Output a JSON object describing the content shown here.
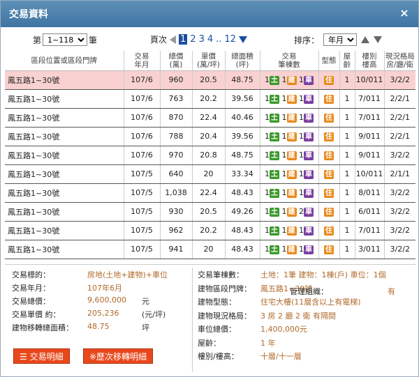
{
  "dialog": {
    "title": "交易資料",
    "close_symbol": "×"
  },
  "toolbar": {
    "page_prefix": "第",
    "page_range": "1~118",
    "page_suffix": "筆",
    "pager_label": "頁次",
    "pages": [
      "1",
      "2",
      "3",
      "4"
    ],
    "ellipsis": "..",
    "last_page": "12",
    "sort_label": "排序：",
    "sort_value": "年月"
  },
  "table": {
    "headers": [
      "區段位置或區段門牌",
      "交易\n年月",
      "總價\n(萬)",
      "單價\n(萬/坪)",
      "總面積\n(坪)",
      "交易\n筆棟數",
      "型態",
      "屋\n齡",
      "樓別\n樓高",
      "現況格局\n房/廳/衛"
    ],
    "rows": [
      {
        "addr": "鳳五路1~30號",
        "ym": "107/6",
        "total": "960",
        "unit": "20.5",
        "area": "48.75",
        "b1": "1",
        "b2": "1",
        "b3": "1",
        "type": "住",
        "age": "1",
        "floor": "10/011",
        "layout": "3/2/2"
      },
      {
        "addr": "鳳五路1~30號",
        "ym": "107/6",
        "total": "763",
        "unit": "20.2",
        "area": "39.56",
        "b1": "1",
        "b2": "1",
        "b3": "1",
        "type": "住",
        "age": "1",
        "floor": "7/011",
        "layout": "2/2/1"
      },
      {
        "addr": "鳳五路1~30號",
        "ym": "107/6",
        "total": "870",
        "unit": "22.4",
        "area": "40.46",
        "b1": "1",
        "b2": "1",
        "b3": "1",
        "type": "住",
        "age": "1",
        "floor": "7/011",
        "layout": "2/2/1"
      },
      {
        "addr": "鳳五路1~30號",
        "ym": "107/6",
        "total": "788",
        "unit": "20.4",
        "area": "39.56",
        "b1": "1",
        "b2": "1",
        "b3": "1",
        "type": "住",
        "age": "1",
        "floor": "9/011",
        "layout": "2/2/1"
      },
      {
        "addr": "鳳五路1~30號",
        "ym": "107/6",
        "total": "970",
        "unit": "20.8",
        "area": "48.75",
        "b1": "1",
        "b2": "1",
        "b3": "1",
        "type": "住",
        "age": "1",
        "floor": "9/011",
        "layout": "3/2/2"
      },
      {
        "addr": "鳳五路1~30號",
        "ym": "107/5",
        "total": "640",
        "unit": "20",
        "area": "33.34",
        "b1": "1",
        "b2": "1",
        "b3": "1",
        "type": "住",
        "age": "1",
        "floor": "10/011",
        "layout": "2/1/1"
      },
      {
        "addr": "鳳五路1~30號",
        "ym": "107/5",
        "total": "1,038",
        "unit": "22.4",
        "area": "48.43",
        "b1": "1",
        "b2": "1",
        "b3": "1",
        "type": "住",
        "age": "1",
        "floor": "8/011",
        "layout": "3/2/2"
      },
      {
        "addr": "鳳五路1~30號",
        "ym": "107/5",
        "total": "930",
        "unit": "20.5",
        "area": "49.26",
        "b1": "1",
        "b2": "1",
        "b3": "2",
        "type": "住",
        "age": "1",
        "floor": "6/011",
        "layout": "3/2/2"
      },
      {
        "addr": "鳳五路1~30號",
        "ym": "107/5",
        "total": "962",
        "unit": "20.2",
        "area": "48.43",
        "b1": "1",
        "b2": "1",
        "b3": "1",
        "type": "住",
        "age": "1",
        "floor": "7/011",
        "layout": "3/2/2"
      },
      {
        "addr": "鳳五路1~30號",
        "ym": "107/5",
        "total": "941",
        "unit": "20",
        "area": "48.43",
        "b1": "1",
        "b2": "1",
        "b3": "1",
        "type": "住",
        "age": "1",
        "floor": "3/011",
        "layout": "3/2/2"
      }
    ],
    "badge_land": "土",
    "badge_build": "建",
    "badge_car": "車"
  },
  "details": {
    "left": [
      {
        "label": "交易標的：",
        "value": "房地(土地+建物)+車位",
        "unit": ""
      },
      {
        "label": "交易年月：",
        "value": "107年6月",
        "unit": ""
      },
      {
        "label": "交易總價：",
        "value": "9,600,000",
        "unit": "元"
      },
      {
        "label": "交易單價 約：",
        "value": "205,236",
        "unit": "(元/坪)"
      },
      {
        "label": "建物移轉總面積：",
        "value": "48.75",
        "unit": "坪"
      }
    ],
    "right": [
      {
        "label": "交易筆棟數：",
        "value": "土地：1筆 建物：1棟(戶) 車位：1個"
      },
      {
        "label": "建物區段門牌：",
        "value": "鳳五路1~30號"
      },
      {
        "label": "建物型態：",
        "value": "住宅大樓(11層含以上有電梯)"
      },
      {
        "label": "建物現況格局：",
        "value": "3 房 2 廳 2 衛 有隔間"
      },
      {
        "label": "車位總價：",
        "value": "1,400,000元"
      },
      {
        "label": "屋齡：",
        "value": "1 年"
      },
      {
        "label": "樓別/樓高：",
        "value": "十層/十一層"
      }
    ],
    "mgmt_label": "管理組織：",
    "mgmt_value": "有",
    "btn_detail": "交易明細",
    "btn_history": "※歷次移轉明細"
  },
  "colors": {
    "title_bar": "#4a7eaa",
    "selected_row": "#f9d1d1",
    "accent": "#e8481c"
  }
}
